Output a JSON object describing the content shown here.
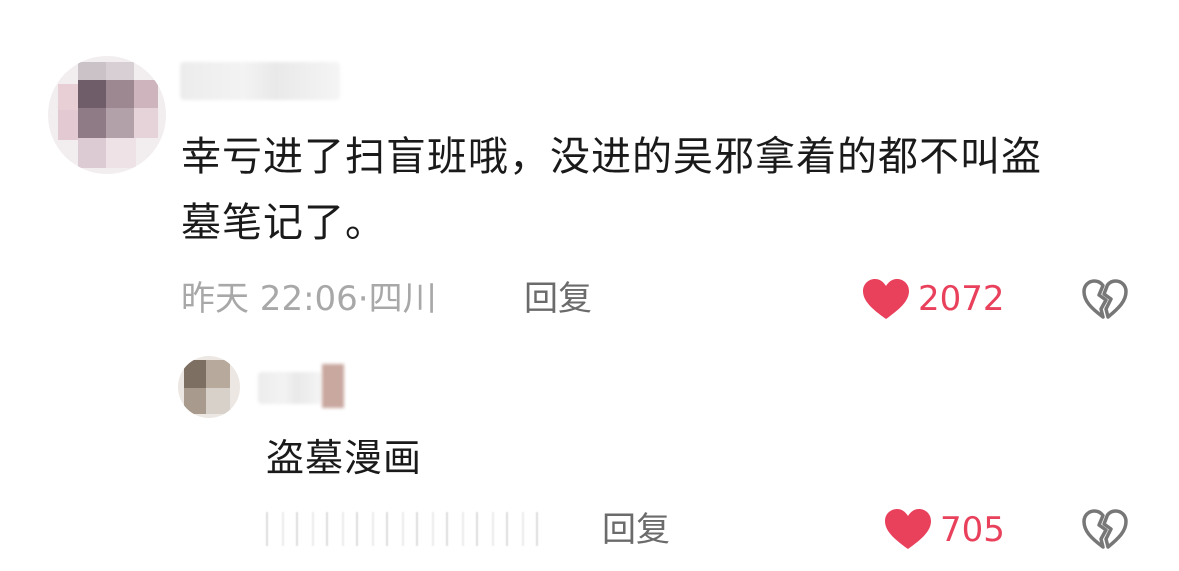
{
  "comment": {
    "text_line1": "幸亏进了扫盲班哦，没进的吴邪拿着的都不叫盗",
    "text_line2": "墓笔记了。",
    "timestamp": "昨天 22:06",
    "separator": "·",
    "location": "四川",
    "reply_label": "回复",
    "like_count": "2072"
  },
  "reply": {
    "text": "盗墓漫画",
    "reply_label": "回复",
    "like_count": "705"
  },
  "colors": {
    "like_red": "#e9405c",
    "meta_gray": "#a8a8a8"
  },
  "icons": {
    "like": "heart-icon",
    "dislike": "broken-heart-icon"
  }
}
